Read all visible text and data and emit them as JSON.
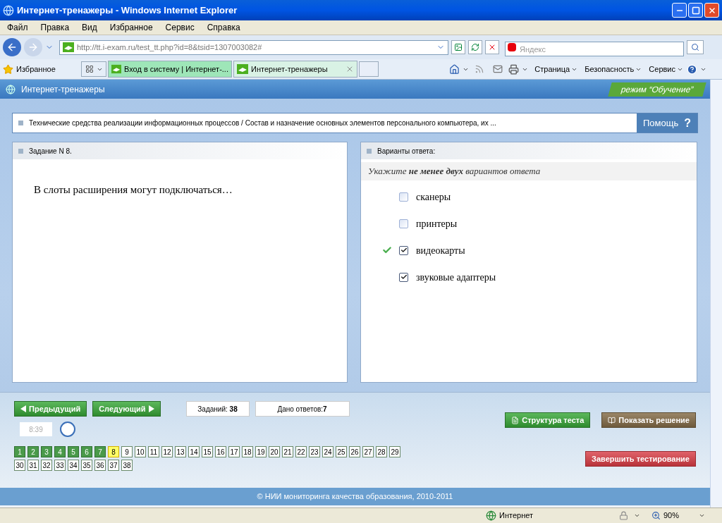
{
  "window": {
    "title": "Интернет-тренажеры - Windows Internet Explorer"
  },
  "menu": [
    "Файл",
    "Правка",
    "Вид",
    "Избранное",
    "Сервис",
    "Справка"
  ],
  "address": {
    "url": "http://tt.i-exam.ru/test_tt.php?id=8&tsid=1307003082#",
    "search_placeholder": "Яндекс"
  },
  "favorites": {
    "label": "Избранное"
  },
  "tabs": [
    {
      "label": "Вход в систему | Интернет-...",
      "selected": false
    },
    {
      "label": "Интернет-тренажеры",
      "selected": true
    }
  ],
  "commands": [
    "Страница",
    "Безопасность",
    "Сервис"
  ],
  "page": {
    "header": "Интернет-тренажеры",
    "mode": "режим “Обучение”",
    "breadcrumb": "Технические средства реализации информационных процессов / Состав и назначение основных элементов персонального компьютера, их ...",
    "help": "Помощь",
    "help_mark": "?",
    "task": {
      "heading": "Задание N 8.",
      "question": "В слоты расширения могут подключаться…"
    },
    "answers": {
      "heading": "Варианты ответа:",
      "instruction": "Укажите **не менее двух** вариантов ответа",
      "options": [
        {
          "label": "сканеры",
          "checked": false,
          "correct": false
        },
        {
          "label": "принтеры",
          "checked": false,
          "correct": false
        },
        {
          "label": "видеокарты",
          "checked": true,
          "correct": true
        },
        {
          "label": "звуковые адаптеры",
          "checked": true,
          "correct": false
        }
      ]
    },
    "prev": "Предыдущий",
    "next": "Следующий",
    "counters": [
      "Заданий: **38**",
      "Дано ответов:**7**"
    ],
    "timer": "8:39",
    "structure": "Структура теста",
    "solution": "Показать решение",
    "finish": "Завершить тестирование",
    "tasks": [
      {
        "label": "1",
        "answered": true,
        "selected": false
      },
      {
        "label": "2",
        "answered": true,
        "selected": false
      },
      {
        "label": "3",
        "answered": true,
        "selected": false
      },
      {
        "label": "4",
        "answered": true,
        "selected": false
      },
      {
        "label": "5",
        "answered": true,
        "selected": false
      },
      {
        "label": "6",
        "answered": true,
        "selected": false
      },
      {
        "label": "7",
        "answered": true,
        "selected": false
      },
      {
        "label": "8",
        "answered": false,
        "selected": true
      },
      {
        "label": "9",
        "answered": false,
        "selected": false
      },
      {
        "label": "10",
        "answered": false,
        "selected": false
      },
      {
        "label": "11",
        "answered": false,
        "selected": false
      },
      {
        "label": "12",
        "answered": false,
        "selected": false
      },
      {
        "label": "13",
        "answered": false,
        "selected": false
      },
      {
        "label": "14",
        "answered": false,
        "selected": false
      },
      {
        "label": "15",
        "answered": false,
        "selected": false
      },
      {
        "label": "16",
        "answered": false,
        "selected": false
      },
      {
        "label": "17",
        "answered": false,
        "selected": false
      },
      {
        "label": "18",
        "answered": false,
        "selected": false
      },
      {
        "label": "19",
        "answered": false,
        "selected": false
      },
      {
        "label": "20",
        "answered": false,
        "selected": false
      },
      {
        "label": "21",
        "answered": false,
        "selected": false
      },
      {
        "label": "22",
        "answered": false,
        "selected": false
      },
      {
        "label": "23",
        "answered": false,
        "selected": false
      },
      {
        "label": "24",
        "answered": false,
        "selected": false
      },
      {
        "label": "25",
        "answered": false,
        "selected": false
      },
      {
        "label": "26",
        "answered": false,
        "selected": false
      },
      {
        "label": "27",
        "answered": false,
        "selected": false
      },
      {
        "label": "28",
        "answered": false,
        "selected": false
      },
      {
        "label": "29",
        "answered": false,
        "selected": false
      },
      {
        "label": "30",
        "answered": false,
        "selected": false
      },
      {
        "label": "31",
        "answered": false,
        "selected": false
      },
      {
        "label": "32",
        "answered": false,
        "selected": false
      },
      {
        "label": "33",
        "answered": false,
        "selected": false
      },
      {
        "label": "34",
        "answered": false,
        "selected": false
      },
      {
        "label": "35",
        "answered": false,
        "selected": false
      },
      {
        "label": "36",
        "answered": false,
        "selected": false
      },
      {
        "label": "37",
        "answered": false,
        "selected": false
      },
      {
        "label": "38",
        "answered": false,
        "selected": false
      }
    ],
    "footer": "© НИИ мониторинга качества образования, 2010-2011"
  },
  "status": {
    "zone": "Интернет",
    "zoom": "90%"
  }
}
